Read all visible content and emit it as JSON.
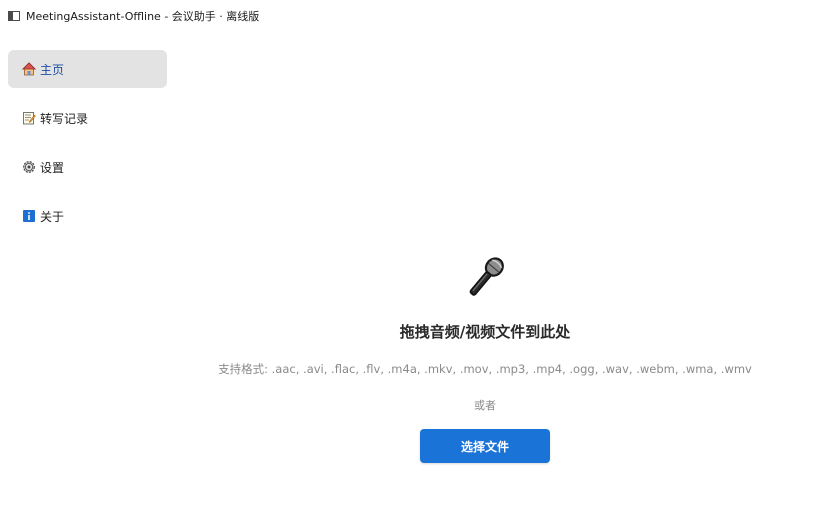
{
  "window": {
    "title": "MeetingAssistant-Offline - 会议助手 · 离线版"
  },
  "sidebar": {
    "items": [
      {
        "label": "主页",
        "icon": "home-icon",
        "active": true
      },
      {
        "label": "转写记录",
        "icon": "memo-icon",
        "active": false
      },
      {
        "label": "设置",
        "icon": "gear-icon",
        "active": false
      },
      {
        "label": "关于",
        "icon": "info-icon",
        "active": false
      }
    ]
  },
  "main": {
    "icon": "microphone-icon",
    "drop_title": "拖拽音频/视频文件到此处",
    "supported_formats": "支持格式: .aac, .avi, .flac, .flv, .m4a, .mkv, .mov, .mp3, .mp4, .ogg, .wav, .webm, .wma, .wmv",
    "or_text": "或者",
    "choose_button_label": "选择文件"
  },
  "colors": {
    "accent": "#1a73d6",
    "active_nav_bg": "#e3e3e3",
    "active_nav_text": "#1f4fa0"
  }
}
